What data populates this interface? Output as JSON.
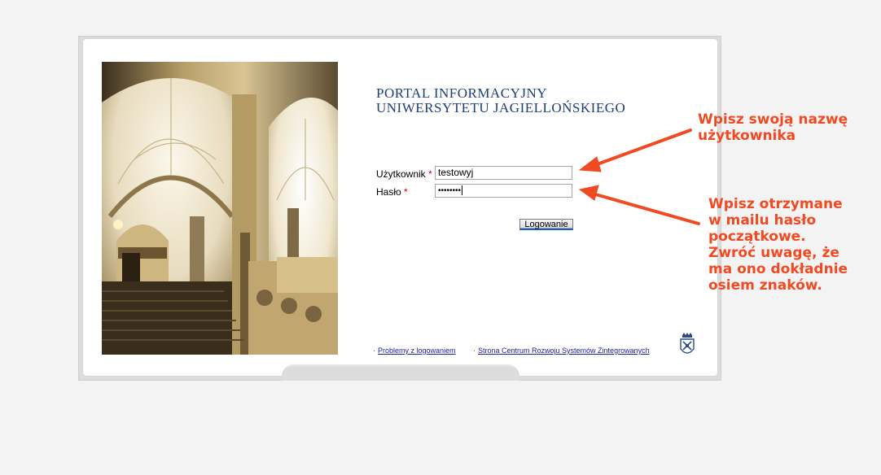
{
  "portal": {
    "title_line1": "PORTAL INFORMACYJNY",
    "title_line2": "UNIWERSYTETU JAGIELLOŃSKIEGO"
  },
  "form": {
    "username_label": "Użytkownik",
    "password_label": "Hasło",
    "required_mark": "*",
    "username_value": "testowyj",
    "password_mask": "••••••••",
    "login_button": "Logowanie"
  },
  "footer": {
    "bullet": "·",
    "link_problems": "Problemy z logowaniem",
    "link_center": "Strona Centrum Rozwoju Systemów Zintegrowanych"
  },
  "annotations": {
    "username_note_line1": "Wpisz swoją nazwę",
    "username_note_line2": "użytkownika",
    "password_note_line1": "Wpisz otrzymane",
    "password_note_line2": "w mailu hasło",
    "password_note_line3": "początkowe.",
    "password_note_line4": "Zwróć uwagę, że",
    "password_note_line5": "ma ono dokładnie",
    "password_note_line6": "osiem znaków.",
    "color": "#f04a23"
  },
  "icons": {
    "crest": "university-crest-icon",
    "photo": "collegium-arcade-photo"
  }
}
